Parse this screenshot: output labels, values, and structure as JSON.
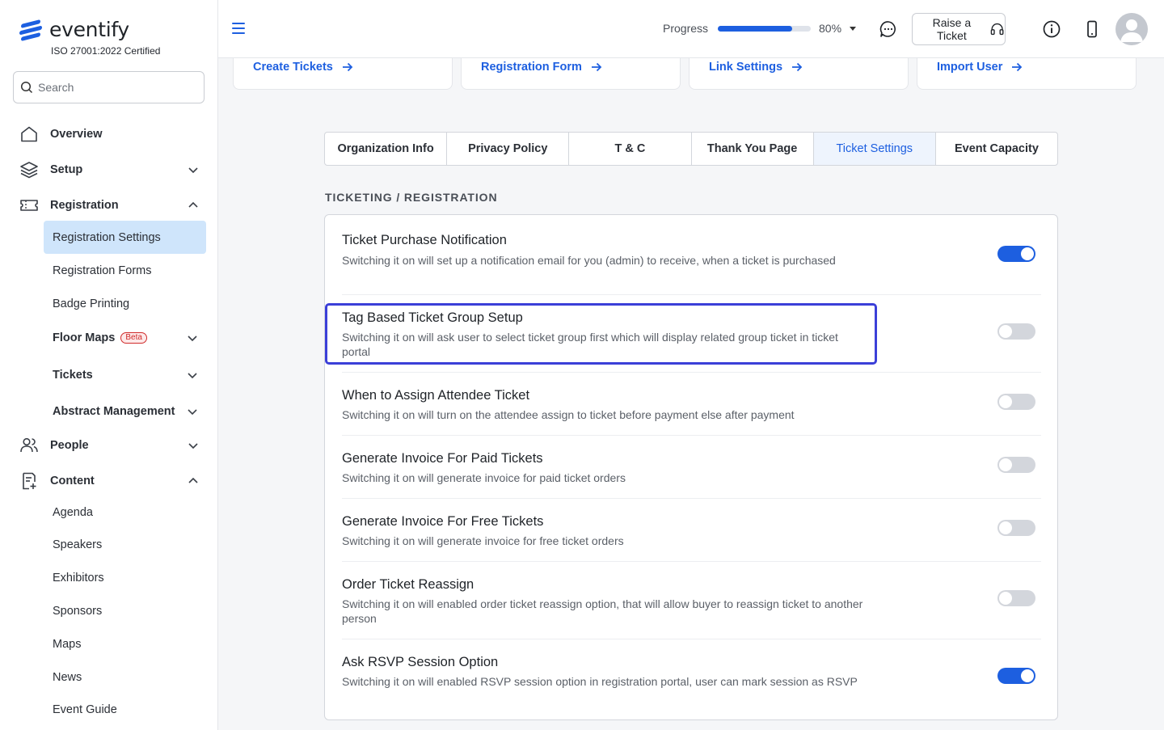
{
  "brand": {
    "name": "eventify",
    "certification": "ISO 27001:2022 Certified",
    "color": "#1d5fe0"
  },
  "search": {
    "placeholder": "Search"
  },
  "sidebar": {
    "overview": "Overview",
    "setup": "Setup",
    "registration": "Registration",
    "registration_items": {
      "settings": "Registration Settings",
      "forms": "Registration Forms",
      "badge": "Badge Printing",
      "floor_maps": "Floor Maps",
      "floor_maps_badge": "Beta",
      "tickets": "Tickets",
      "abstract": "Abstract Management"
    },
    "people": "People",
    "content": "Content",
    "content_items": {
      "agenda": "Agenda",
      "speakers": "Speakers",
      "exhibitors": "Exhibitors",
      "sponsors": "Sponsors",
      "maps": "Maps",
      "news": "News",
      "event_guide": "Event Guide"
    }
  },
  "header": {
    "progress_label": "Progress",
    "progress_value": 0.8,
    "progress_text": "80%",
    "raise_ticket": "Raise a Ticket"
  },
  "quick_links": {
    "create_tickets": "Create Tickets",
    "registration_form": "Registration Form",
    "link_settings": "Link Settings",
    "import_user": "Import User"
  },
  "tabs": {
    "org_info": "Organization Info",
    "privacy": "Privacy Policy",
    "tc": "T & C",
    "thank_you": "Thank You Page",
    "ticket_settings": "Ticket Settings",
    "capacity": "Event Capacity",
    "active": "ticket_settings"
  },
  "section_title": "TICKETING / REGISTRATION",
  "settings": [
    {
      "title": "Ticket Purchase Notification",
      "desc": "Switching it on will set up a notification email for you (admin) to receive, when a ticket is purchased",
      "enabled": true
    },
    {
      "title": "Tag Based Ticket Group Setup",
      "desc": "Switching it on will ask user to select ticket group first which will display related group ticket in ticket portal",
      "enabled": false
    },
    {
      "title": "When to Assign Attendee Ticket",
      "desc": "Switching it on will turn on the attendee assign to ticket before payment else after payment",
      "enabled": false
    },
    {
      "title": "Generate Invoice For Paid Tickets",
      "desc": "Switching it on will generate invoice for paid ticket orders",
      "enabled": false
    },
    {
      "title": "Generate Invoice For Free Tickets",
      "desc": "Switching it on will generate invoice for free ticket orders",
      "enabled": false
    },
    {
      "title": "Order Ticket Reassign",
      "desc": "Switching it on will enabled order ticket reassign option, that will allow buyer to reassign ticket to another person",
      "enabled": false
    },
    {
      "title": "Ask RSVP Session Option",
      "desc": "Switching it on will enabled RSVP session option in registration portal, user can mark session as RSVP",
      "enabled": true
    }
  ]
}
